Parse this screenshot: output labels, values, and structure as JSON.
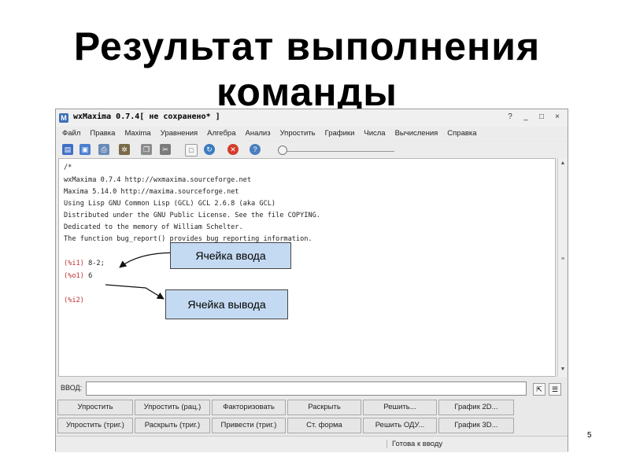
{
  "slide": {
    "title_line1": "Результат выполнения",
    "title_line2": "команды",
    "page_number": "5"
  },
  "window": {
    "title": "wxMaxima 0.7.4[ не сохранено* ]",
    "controls": [
      "?",
      "_",
      "□",
      "×"
    ]
  },
  "menu": [
    "Файл",
    "Правка",
    "Maxima",
    "Уравнения",
    "Алгебра",
    "Анализ",
    "Упростить",
    "Графики",
    "Числа",
    "Вычисления",
    "Справка"
  ],
  "toolbar": {
    "icons": [
      "open-icon",
      "save-icon",
      "print-icon",
      "settings-icon",
      "copy-icon",
      "cut-icon",
      "new-cell-icon",
      "link-icon",
      "stop-icon",
      "help-icon"
    ]
  },
  "document": {
    "header_lines": [
      "/*",
      "wxMaxima 0.7.4 http://wxmaxima.sourceforge.net",
      "Maxima 5.14.0 http://maxima.sourceforge.net",
      "Using Lisp GNU Common Lisp (GCL) GCL 2.6.8 (aka GCL)",
      "Distributed under the GNU Public License. See the file COPYING.",
      "Dedicated to the memory of William Schelter.",
      "The function bug_report() provides bug reporting information."
    ],
    "cells": [
      {
        "label": "(%i1)",
        "content": "8-2;"
      },
      {
        "label": "(%o1)",
        "content": "6"
      },
      {
        "label": "(%i2)",
        "content": ""
      }
    ]
  },
  "callouts": {
    "input_cell": "Ячейка ввода",
    "output_cell": "Ячейка вывода"
  },
  "input_bar": {
    "label": "ВВОД:",
    "value": ""
  },
  "buttons": {
    "row1": [
      "Упростить",
      "Упростить (рац.)",
      "Факторизовать",
      "Раскрыть",
      "Решить...",
      "График 2D..."
    ],
    "row2": [
      "Упростить (триг.)",
      "Раскрыть (триг.)",
      "Привести (триг.)",
      "Ст. форма",
      "Решить ОДУ...",
      "График 3D..."
    ]
  },
  "status": "Готова к вводу"
}
